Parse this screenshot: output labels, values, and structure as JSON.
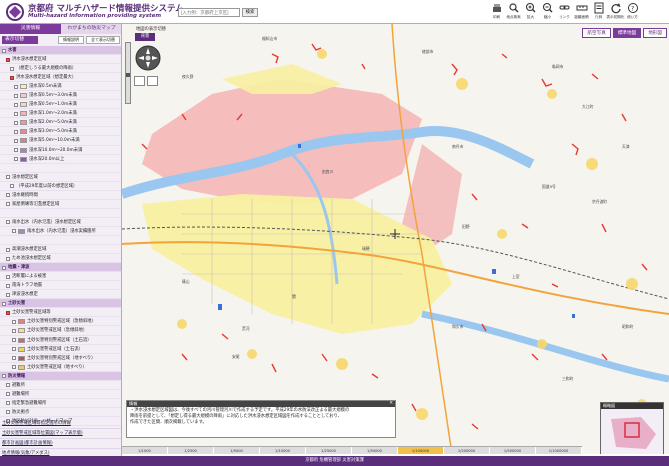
{
  "header": {
    "title_ja": "京都府 マルチハザード情報提供システム",
    "title_en": "Multi-hazard information providing system",
    "address_placeholder": "[入力例：京都府上京区]",
    "search_label": "検索",
    "toolbar": [
      {
        "label": "印刷",
        "icon": "printer-icon"
      },
      {
        "label": "地点検索",
        "icon": "search-pin-icon"
      },
      {
        "label": "拡大",
        "icon": "zoom-in-icon"
      },
      {
        "label": "縮小",
        "icon": "zoom-out-icon"
      },
      {
        "label": "リンク",
        "icon": "link-icon"
      },
      {
        "label": "距離面積",
        "icon": "measure-icon"
      },
      {
        "label": "凡例",
        "icon": "legend-icon"
      },
      {
        "label": "表示初期化",
        "icon": "refresh-icon"
      },
      {
        "label": "使い方",
        "icon": "help-icon"
      }
    ]
  },
  "sidebar": {
    "tabs": [
      "災害情報",
      "わがまちの防災マップ"
    ],
    "display_toggle": "表示切替",
    "explanation_button": "情報説明",
    "clear_button": "全て表示切替",
    "rows": [
      {
        "type": "cat",
        "label": "水害",
        "indent": 0,
        "checked": false,
        "swatch": ""
      },
      {
        "type": "item",
        "label": "洪水浸水想定区域",
        "indent": 4,
        "checked": true,
        "swatch": ""
      },
      {
        "type": "item",
        "label": "（想定しうる最大規模の降雨）",
        "indent": 8,
        "checked": false,
        "swatch": ""
      },
      {
        "type": "item",
        "label": "洪水浸水想定区域（想定最大）",
        "indent": 8,
        "checked": true,
        "swatch": ""
      },
      {
        "type": "item",
        "label": "浸水深0.5m未満",
        "indent": 12,
        "checked": false,
        "swatch": "#f8f2a6"
      },
      {
        "type": "item",
        "label": "浸水深0.5m〜3.0m未満",
        "indent": 12,
        "checked": false,
        "swatch": "#f4c9c9"
      },
      {
        "type": "item",
        "label": "浸水深0.5m〜1.0m未満",
        "indent": 12,
        "checked": false,
        "swatch": "#f7d6b6"
      },
      {
        "type": "item",
        "label": "浸水深1.0m〜2.0m未満",
        "indent": 12,
        "checked": false,
        "swatch": "#f4b3b3"
      },
      {
        "type": "item",
        "label": "浸水深2.0m〜5.0m未満",
        "indent": 12,
        "checked": false,
        "swatch": "#ee9999"
      },
      {
        "type": "item",
        "label": "浸水深3.0m〜5.0m未満",
        "indent": 12,
        "checked": false,
        "swatch": "#e58a9a"
      },
      {
        "type": "item",
        "label": "浸水深5.0m〜10.0m未満",
        "indent": 12,
        "checked": false,
        "swatch": "#d97aa8"
      },
      {
        "type": "item",
        "label": "浸水深10.0m〜20.0m未満",
        "indent": 12,
        "checked": false,
        "swatch": "#b27ac4"
      },
      {
        "type": "item",
        "label": "浸水深20.0m以上",
        "indent": 12,
        "checked": false,
        "swatch": "#8a5bb0"
      },
      {
        "type": "item",
        "label": "",
        "indent": 0,
        "checked": false,
        "swatch": ""
      },
      {
        "type": "item",
        "label": "浸水想定区域",
        "indent": 4,
        "checked": false,
        "swatch": ""
      },
      {
        "type": "item",
        "label": "（平成29年度以前の想定区域）",
        "indent": 8,
        "checked": false,
        "swatch": ""
      },
      {
        "type": "item",
        "label": "浸水継続時間",
        "indent": 4,
        "checked": false,
        "swatch": ""
      },
      {
        "type": "item",
        "label": "家屋倒壊等氾濫想定区域",
        "indent": 4,
        "checked": false,
        "swatch": ""
      },
      {
        "type": "item",
        "label": "",
        "indent": 0,
        "checked": false,
        "swatch": ""
      },
      {
        "type": "item",
        "label": "雨水出水（内水氾濫）浸水想定区域",
        "indent": 4,
        "checked": false,
        "swatch": ""
      },
      {
        "type": "item",
        "label": "雨水出水（内水氾濫）浸水実績箇所",
        "indent": 10,
        "checked": false,
        "swatch": "#9b8fb8"
      },
      {
        "type": "item",
        "label": "",
        "indent": 0,
        "checked": false,
        "swatch": ""
      },
      {
        "type": "item",
        "label": "高潮浸水想定区域",
        "indent": 4,
        "checked": false,
        "swatch": ""
      },
      {
        "type": "item",
        "label": "ため池浸水想定区域",
        "indent": 4,
        "checked": false,
        "swatch": ""
      },
      {
        "type": "cat",
        "label": "地震・津波",
        "indent": 0,
        "checked": false,
        "swatch": ""
      },
      {
        "type": "item",
        "label": "活断層による被害",
        "indent": 4,
        "checked": false,
        "swatch": ""
      },
      {
        "type": "item",
        "label": "南海トラフ地震",
        "indent": 4,
        "checked": false,
        "swatch": ""
      },
      {
        "type": "item",
        "label": "津波浸水想定",
        "indent": 4,
        "checked": false,
        "swatch": ""
      },
      {
        "type": "cat",
        "label": "土砂災害",
        "indent": 0,
        "checked": false,
        "swatch": ""
      },
      {
        "type": "item",
        "label": "土砂災害警戒区域等",
        "indent": 4,
        "checked": true,
        "swatch": ""
      },
      {
        "type": "item",
        "label": "土砂災害特別警戒区域（急傾斜地）",
        "indent": 10,
        "checked": false,
        "swatch": "#e98080"
      },
      {
        "type": "item",
        "label": "土砂災害警戒区域（急傾斜地）",
        "indent": 10,
        "checked": false,
        "swatch": "#f5e36b"
      },
      {
        "type": "item",
        "label": "土砂災害特別警戒区域（土石流）",
        "indent": 10,
        "checked": false,
        "swatch": "#e06262"
      },
      {
        "type": "item",
        "label": "土砂災害警戒区域（土石流）",
        "indent": 10,
        "checked": false,
        "swatch": "#f2d25a"
      },
      {
        "type": "item",
        "label": "土砂災害特別警戒区域（地すべり）",
        "indent": 10,
        "checked": false,
        "swatch": "#c94b4b"
      },
      {
        "type": "item",
        "label": "土砂災害警戒区域（地すべり）",
        "indent": 10,
        "checked": false,
        "swatch": "#efc86a"
      },
      {
        "type": "cat",
        "label": "防災情報",
        "indent": 0,
        "checked": false,
        "swatch": ""
      },
      {
        "type": "item",
        "label": "避難所",
        "indent": 4,
        "checked": false,
        "swatch": ""
      },
      {
        "type": "item",
        "label": "避難場所",
        "indent": 4,
        "checked": false,
        "swatch": ""
      },
      {
        "type": "item",
        "label": "指定緊急避難場所",
        "indent": 4,
        "checked": false,
        "swatch": ""
      },
      {
        "type": "item",
        "label": "防災拠点",
        "indent": 4,
        "checked": false,
        "swatch": ""
      },
      {
        "type": "item",
        "label": "地区防災計画・ハザードマップ",
        "indent": 4,
        "checked": false,
        "swatch": ""
      }
    ],
    "links": [
      "土砂災害警戒区域等指定箇所の情報",
      "土砂災害警戒区域等位置図(マップ表示版)",
      "都市計画図(都市計画情報)",
      "地点情報(気象/アメダス)"
    ]
  },
  "map": {
    "area_label": "地図の表示切替",
    "bg_toggle": "背景",
    "tabs": [
      "航空写真",
      "標準地図",
      "地形図"
    ],
    "active_tab_index": 1,
    "labels": [
      "福知山市",
      "綾部市",
      "亀岡市",
      "南丹市",
      "由良川",
      "国道9号",
      "京丹波町",
      "田野",
      "瑞穂",
      "篠山",
      "上宮",
      "関",
      "昭和町",
      "和久市",
      "荒河",
      "安尾",
      "大江町",
      "夜久野",
      "三和町",
      "天津"
    ],
    "info_title": "情報",
    "info_lines": [
      "・洪水浸水想定区域図は、今後すべての河川管理河川で作成する予定です。平成29年の水防法改正よる最大規模の",
      "降雨を前提として、「想定し得る最大規模の降雨」に対応した洪水浸水想定区域図を作成することとしており、",
      "作成できた区間、順次掲載しています。"
    ],
    "overview_title": "概略図",
    "scales": [
      "1/1000",
      "1/2500",
      "1/5000",
      "1/10000",
      "1/25000",
      "1/50000",
      "1/100000",
      "1/200000",
      "1/500000",
      "1/1000000"
    ],
    "active_scale_index": 6
  },
  "footer": {
    "text": "京都府 危機管理部 災害対策課"
  },
  "colors": {
    "brand": "#5a2e7a",
    "accent": "#7b3b9b",
    "flood_pink": "#f4b3b3",
    "flood_yellow": "#f8f2a6",
    "river": "#9ac7ef",
    "landslide": "#e53935"
  }
}
